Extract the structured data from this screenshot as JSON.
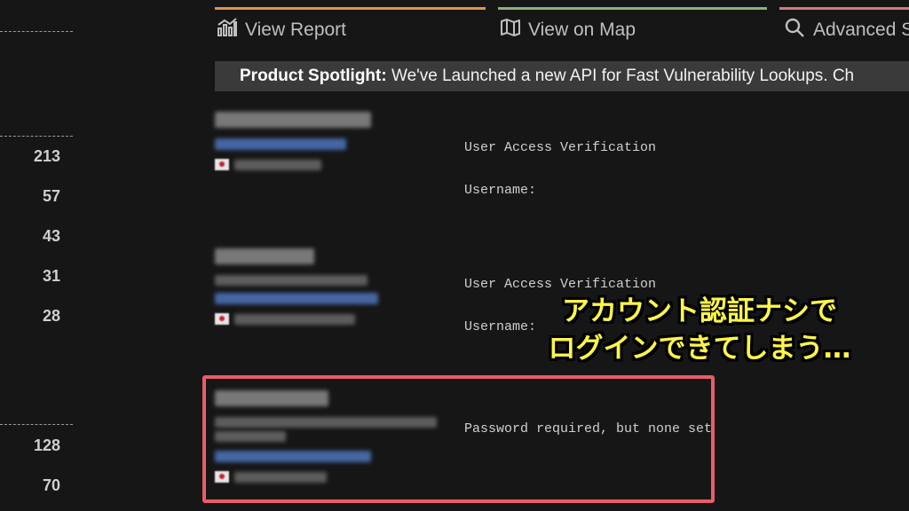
{
  "sidebar": {
    "counts": [
      "213",
      "57",
      "43",
      "31",
      "28",
      "128",
      "70"
    ]
  },
  "tabs": [
    {
      "label": "View Report",
      "icon": "chart-icon",
      "color": "#e0944a"
    },
    {
      "label": "View on Map",
      "icon": "map-icon",
      "color": "#86b27a"
    },
    {
      "label": "Advanced S",
      "icon": "search-icon",
      "color": "#d67a7a"
    }
  ],
  "banner": {
    "bold": "Product Spotlight:",
    "text": " We've Launched a new API for Fast Vulnerability Lookups. Ch"
  },
  "results": [
    {
      "banner_lines": [
        "User Access Verification",
        "Username:"
      ]
    },
    {
      "banner_lines": [
        "User Access Verification",
        "Username:"
      ]
    },
    {
      "banner_lines": [
        "Password required, but none set"
      ]
    }
  ],
  "annotation": {
    "line1": "アカウント認証ナシで",
    "line2": "ログインできてしまう…",
    "color": "#fff64a"
  },
  "highlight_color": "#e85d67"
}
